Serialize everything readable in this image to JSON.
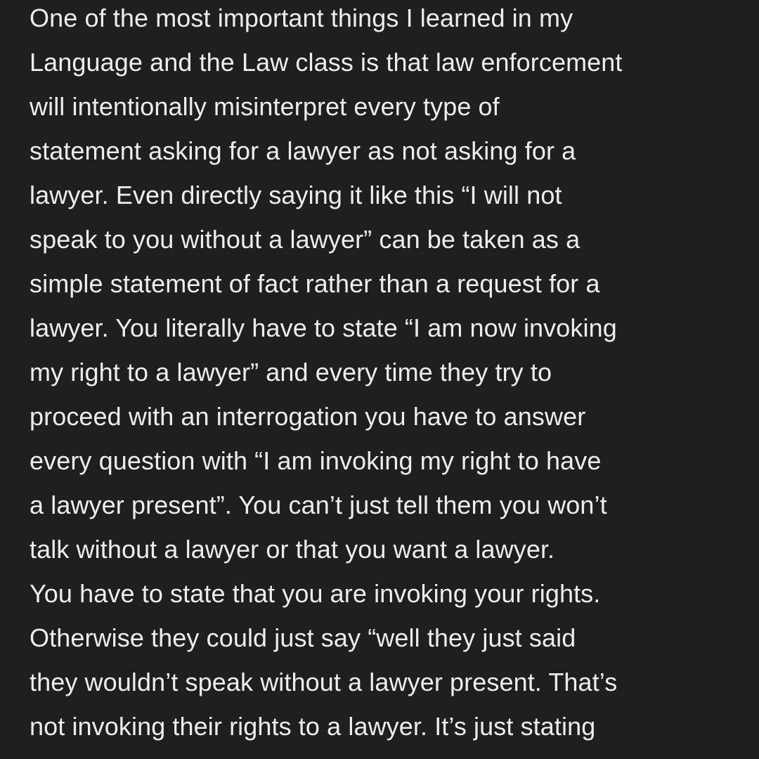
{
  "post": {
    "lines": [
      "One of the most important things I learned in my",
      "Language and the Law class is that law enforcement",
      "will intentionally misinterpret every type of",
      "statement asking for a lawyer as not asking for a",
      "lawyer. Even directly saying it like this “I will not",
      "speak to you without a lawyer” can be taken as a",
      "simple statement of fact rather than a request for a",
      "lawyer. You literally have to state “I am now invoking",
      "my right to a lawyer” and every time they try to",
      "proceed with an interrogation you have to answer",
      "every question with “I am invoking my right to have",
      "a lawyer present”. You can’t just tell them you won’t",
      "talk without a lawyer or that you want a lawyer.",
      "You have to state that you are invoking your rights.",
      "Otherwise they could just say “well they just said",
      "they wouldn’t speak without a lawyer present. That’s",
      "not invoking their rights to a lawyer. It’s just stating"
    ]
  },
  "colors": {
    "background": "#1f1f1f",
    "text": "#ededed"
  }
}
